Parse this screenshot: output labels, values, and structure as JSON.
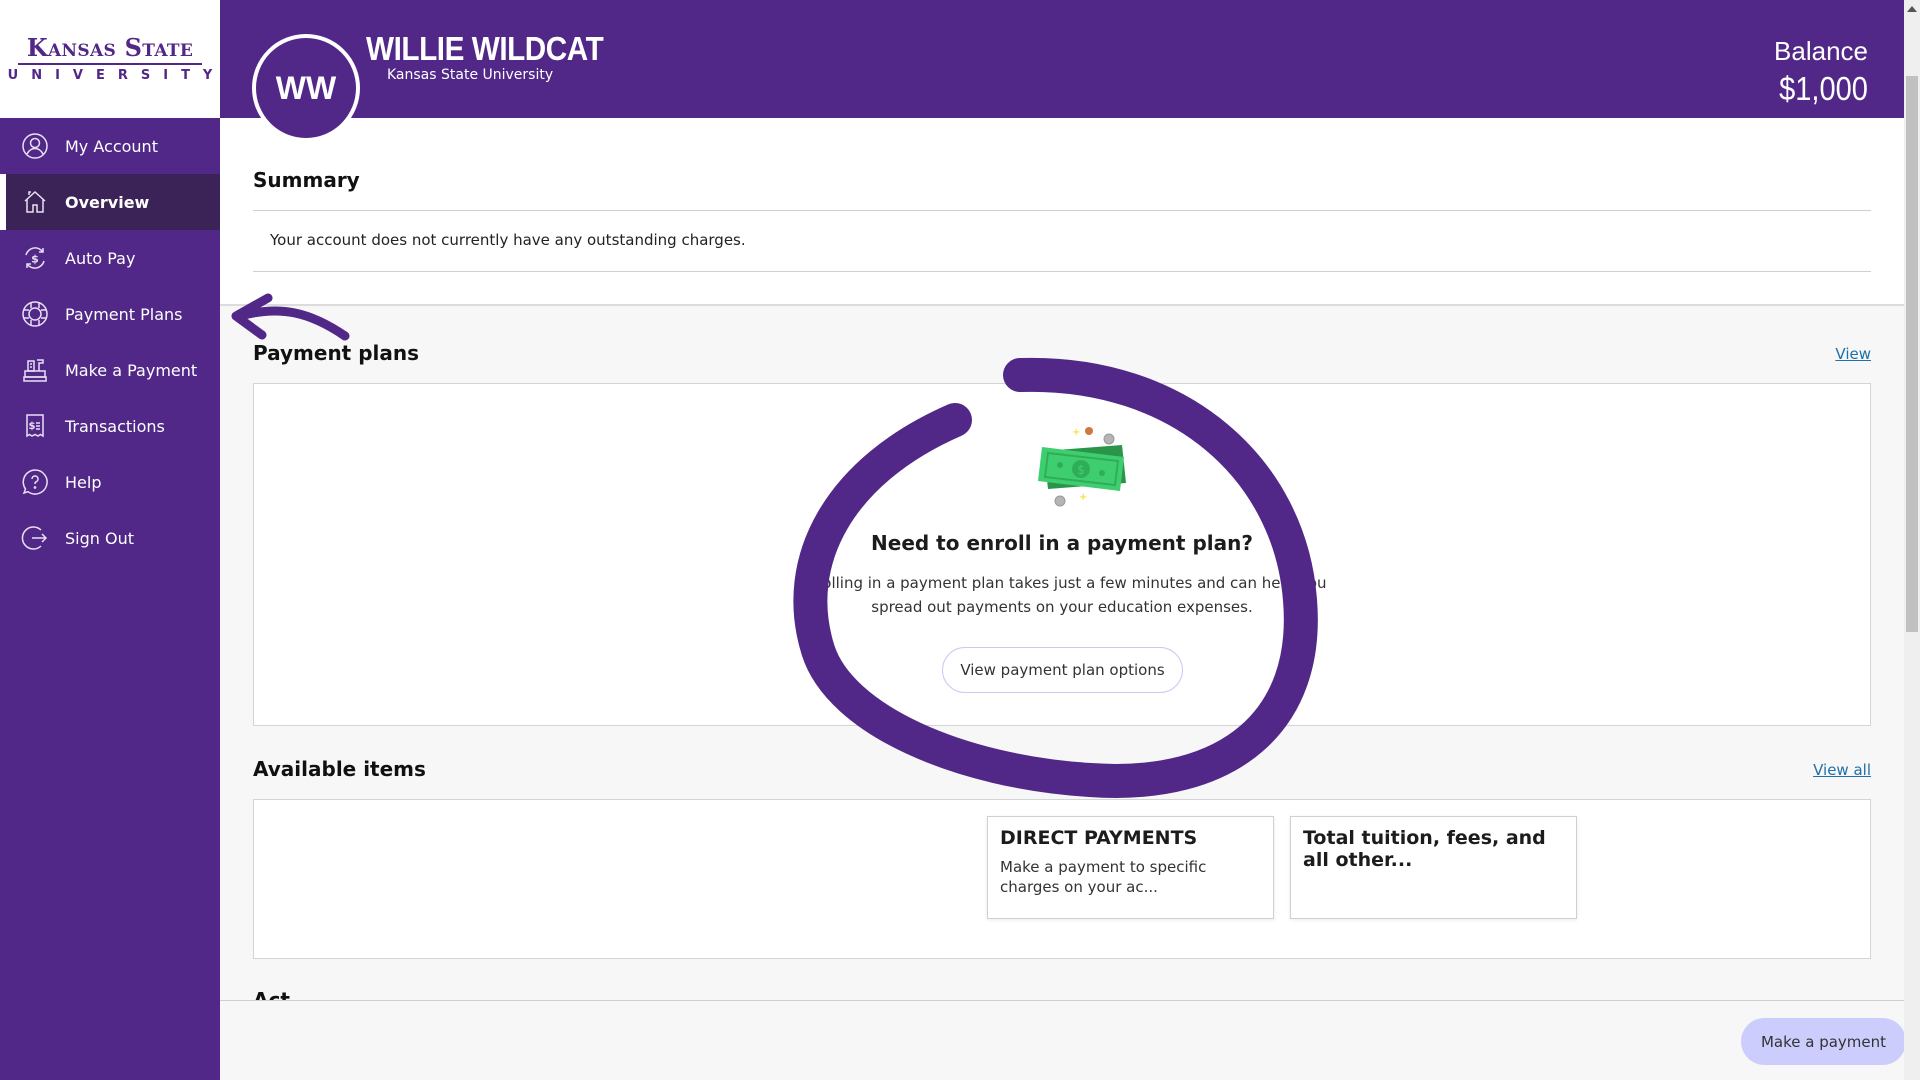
{
  "brand": {
    "logo_line1": "Kansas State",
    "logo_line2": "UNIVERSITY",
    "primary_color": "#512888"
  },
  "sidebar": {
    "items": [
      {
        "label": "My Account",
        "icon": "user-circle-icon",
        "active": false
      },
      {
        "label": "Overview",
        "icon": "home-icon",
        "active": true
      },
      {
        "label": "Auto Pay",
        "icon": "autopay-dollar-icon",
        "active": false
      },
      {
        "label": "Payment Plans",
        "icon": "lifebuoy-icon",
        "active": false
      },
      {
        "label": "Make a Payment",
        "icon": "cash-register-icon",
        "active": false
      },
      {
        "label": "Transactions",
        "icon": "receipt-icon",
        "active": false
      },
      {
        "label": "Help",
        "icon": "help-bubble-icon",
        "active": false
      },
      {
        "label": "Sign Out",
        "icon": "sign-out-icon",
        "active": false
      }
    ]
  },
  "header": {
    "avatar_initials": "WW",
    "user_name": "WILLIE WILDCAT",
    "school": "Kansas State University",
    "balance_label": "Balance",
    "balance_value": "$1,000"
  },
  "summary": {
    "title": "Summary",
    "message": "Your account does not currently have any outstanding charges."
  },
  "payment_plans": {
    "title": "Payment plans",
    "view_link": "View",
    "illustration": "money-cash-icon",
    "heading": "Need to enroll in a payment plan?",
    "body_line1": "Enrolling in a payment plan takes just a few minutes and can help you",
    "body_line2": "spread out payments on your education expenses.",
    "button_label": "View payment plan options"
  },
  "available_items": {
    "title": "Available items",
    "view_all_link": "View all",
    "items": [
      {
        "title": "DIRECT PAYMENTS",
        "description": "Make a payment to specific charges on your ac..."
      },
      {
        "title": "Total tuition, fees, and all other...",
        "description": ""
      }
    ]
  },
  "cutoff_section": {
    "title": "Act..."
  },
  "footer": {
    "make_payment_label": "Make a payment"
  },
  "annotations": {
    "arrow": "pointing to Payment Plans sidebar item",
    "circle": "highlighting payment plan enrollment prompt",
    "color": "#512888"
  }
}
